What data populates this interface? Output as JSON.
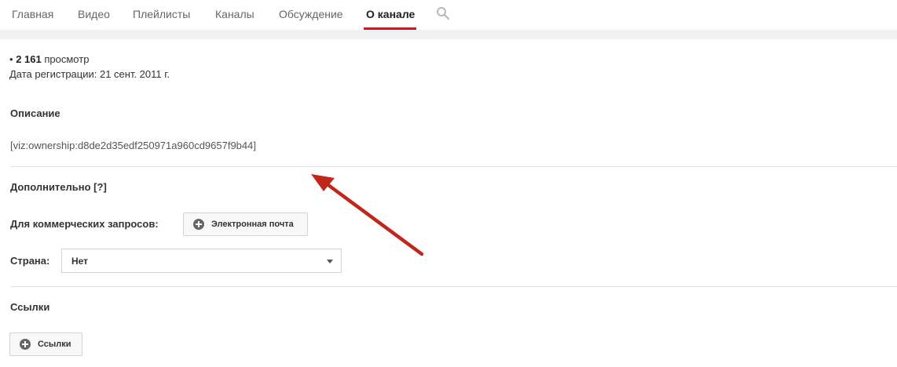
{
  "tabs": [
    {
      "label": "Главная"
    },
    {
      "label": "Видео"
    },
    {
      "label": "Плейлисты"
    },
    {
      "label": "Каналы"
    },
    {
      "label": "Обсуждение"
    },
    {
      "label": "О канале",
      "active": true
    }
  ],
  "search_icon": "search-icon",
  "stats": {
    "bullet": "•",
    "views_count": "2 161",
    "views_label": "просмотр",
    "registration": "Дата регистрации: 21 сент. 2011 г."
  },
  "description": {
    "title": "Описание",
    "text": "[viz:ownership:d8de2d35edf250971a960cd9657f9b44]"
  },
  "additional": {
    "title": "Дополнительно [?]",
    "business_label": "Для коммерческих запросов:",
    "email_button": "Электронная почта",
    "country_label": "Страна:",
    "country_value": "Нет"
  },
  "links": {
    "title": "Ссылки",
    "button": "Ссылки"
  },
  "colors": {
    "accent": "#cc181e",
    "annotation_arrow": "#c0271a"
  }
}
